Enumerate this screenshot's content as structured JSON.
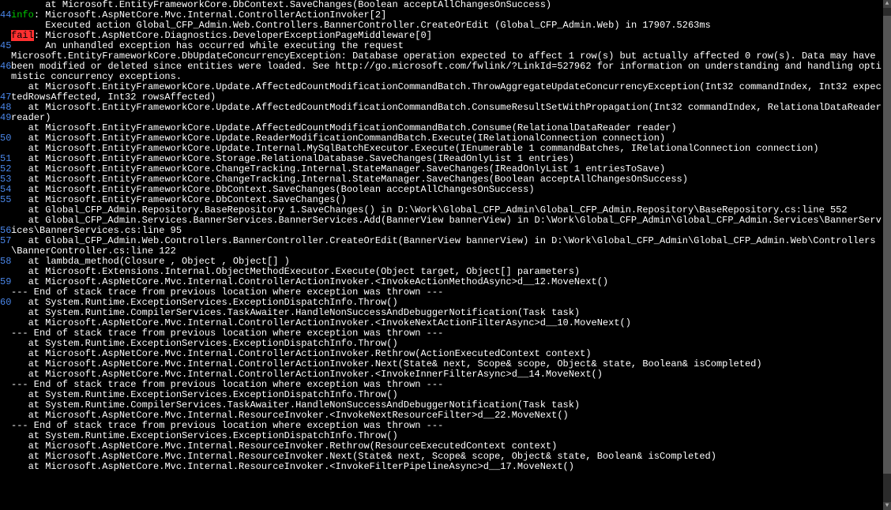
{
  "gutter": "  \n44\n  \n  \n45\n  \n46\n  \n  \n47\n48\n49\n  \n50\n  \n51\n52\n53\n54\n55\n  \n  \n56\n57\n  \n58\n  \n59\n  \n60",
  "lines": [
    {
      "t": "      at Microsoft.EntityFrameworkCore.DbContext.SaveChanges(Boolean acceptAllChangesOnSuccess)"
    },
    {
      "prefix": "info",
      "t": ": Microsoft.AspNetCore.Mvc.Internal.ControllerActionInvoker[2]"
    },
    {
      "t": "      Executed action Global_CFP_Admin.Web.Controllers.BannerController.CreateOrEdit (Global_CFP_Admin.Web) in 17907.5263ms"
    },
    {
      "prefix": "fail",
      "t": ": Microsoft.AspNetCore.Diagnostics.DeveloperExceptionPageMiddleware[0]"
    },
    {
      "t": "      An unhandled exception has occurred while executing the request"
    },
    {
      "t": "Microsoft.EntityFrameworkCore.DbUpdateConcurrencyException: Database operation expected to affect 1 row(s) but actually affected 0 row(s). Data may have been modified or deleted since entities were loaded. See http://go.microsoft.com/fwlink/?LinkId=527962 for information on understanding and handling optimistic concurrency exceptions."
    },
    {
      "t": "   at Microsoft.EntityFrameworkCore.Update.AffectedCountModificationCommandBatch.ThrowAggregateUpdateConcurrencyException(Int32 commandIndex, Int32 expectedRowsAffected, Int32 rowsAffected)"
    },
    {
      "t": "   at Microsoft.EntityFrameworkCore.Update.AffectedCountModificationCommandBatch.ConsumeResultSetWithPropagation(Int32 commandIndex, RelationalDataReader reader)"
    },
    {
      "t": "   at Microsoft.EntityFrameworkCore.Update.AffectedCountModificationCommandBatch.Consume(RelationalDataReader reader)"
    },
    {
      "t": "   at Microsoft.EntityFrameworkCore.Update.ReaderModificationCommandBatch.Execute(IRelationalConnection connection)"
    },
    {
      "t": "   at Microsoft.EntityFrameworkCore.Update.Internal.MySqlBatchExecutor.Execute(IEnumerable 1 commandBatches, IRelationalConnection connection)"
    },
    {
      "t": "   at Microsoft.EntityFrameworkCore.Storage.RelationalDatabase.SaveChanges(IReadOnlyList 1 entries)"
    },
    {
      "t": "   at Microsoft.EntityFrameworkCore.ChangeTracking.Internal.StateManager.SaveChanges(IReadOnlyList 1 entriesToSave)"
    },
    {
      "t": "   at Microsoft.EntityFrameworkCore.ChangeTracking.Internal.StateManager.SaveChanges(Boolean acceptAllChangesOnSuccess)"
    },
    {
      "t": "   at Microsoft.EntityFrameworkCore.DbContext.SaveChanges(Boolean acceptAllChangesOnSuccess)"
    },
    {
      "t": "   at Microsoft.EntityFrameworkCore.DbContext.SaveChanges()"
    },
    {
      "t": "   at Global_CFP_Admin.Repository.BaseRepository 1.SaveChanges() in D:\\Work\\Global_CFP_Admin\\Global_CFP_Admin.Repository\\BaseRepository.cs:line 552"
    },
    {
      "t": "   at Global_CFP_Admin.Services.BannerServices.BannerServices.Add(BannerView bannerView) in D:\\Work\\Global_CFP_Admin\\Global_CFP_Admin.Services\\BannerServices\\BannerServices.cs:line 95"
    },
    {
      "t": "   at Global_CFP_Admin.Web.Controllers.BannerController.CreateOrEdit(BannerView bannerView) in D:\\Work\\Global_CFP_Admin\\Global_CFP_Admin.Web\\Controllers\\BannerController.cs:line 122"
    },
    {
      "t": "   at lambda_method(Closure , Object , Object[] )"
    },
    {
      "t": "   at Microsoft.Extensions.Internal.ObjectMethodExecutor.Execute(Object target, Object[] parameters)"
    },
    {
      "t": "   at Microsoft.AspNetCore.Mvc.Internal.ControllerActionInvoker.<InvokeActionMethodAsync>d__12.MoveNext()"
    },
    {
      "t": "--- End of stack trace from previous location where exception was thrown ---"
    },
    {
      "t": "   at System.Runtime.ExceptionServices.ExceptionDispatchInfo.Throw()"
    },
    {
      "t": "   at System.Runtime.CompilerServices.TaskAwaiter.HandleNonSuccessAndDebuggerNotification(Task task)"
    },
    {
      "t": "   at Microsoft.AspNetCore.Mvc.Internal.ControllerActionInvoker.<InvokeNextActionFilterAsync>d__10.MoveNext()"
    },
    {
      "t": "--- End of stack trace from previous location where exception was thrown ---"
    },
    {
      "t": "   at System.Runtime.ExceptionServices.ExceptionDispatchInfo.Throw()"
    },
    {
      "t": "   at Microsoft.AspNetCore.Mvc.Internal.ControllerActionInvoker.Rethrow(ActionExecutedContext context)"
    },
    {
      "t": "   at Microsoft.AspNetCore.Mvc.Internal.ControllerActionInvoker.Next(State& next, Scope& scope, Object& state, Boolean& isCompleted)"
    },
    {
      "t": "   at Microsoft.AspNetCore.Mvc.Internal.ControllerActionInvoker.<InvokeInnerFilterAsync>d__14.MoveNext()"
    },
    {
      "t": "--- End of stack trace from previous location where exception was thrown ---"
    },
    {
      "t": "   at System.Runtime.ExceptionServices.ExceptionDispatchInfo.Throw()"
    },
    {
      "t": "   at System.Runtime.CompilerServices.TaskAwaiter.HandleNonSuccessAndDebuggerNotification(Task task)"
    },
    {
      "t": "   at Microsoft.AspNetCore.Mvc.Internal.ResourceInvoker.<InvokeNextResourceFilter>d__22.MoveNext()"
    },
    {
      "t": "--- End of stack trace from previous location where exception was thrown ---"
    },
    {
      "t": "   at System.Runtime.ExceptionServices.ExceptionDispatchInfo.Throw()"
    },
    {
      "t": "   at Microsoft.AspNetCore.Mvc.Internal.ResourceInvoker.Rethrow(ResourceExecutedContext context)"
    },
    {
      "t": "   at Microsoft.AspNetCore.Mvc.Internal.ResourceInvoker.Next(State& next, Scope& scope, Object& state, Boolean& isCompleted)"
    },
    {
      "t": "   at Microsoft.AspNetCore.Mvc.Internal.ResourceInvoker.<InvokeFilterPipelineAsync>d__17.MoveNext()"
    }
  ],
  "scroll": {
    "up": "▲",
    "down": "▼"
  }
}
